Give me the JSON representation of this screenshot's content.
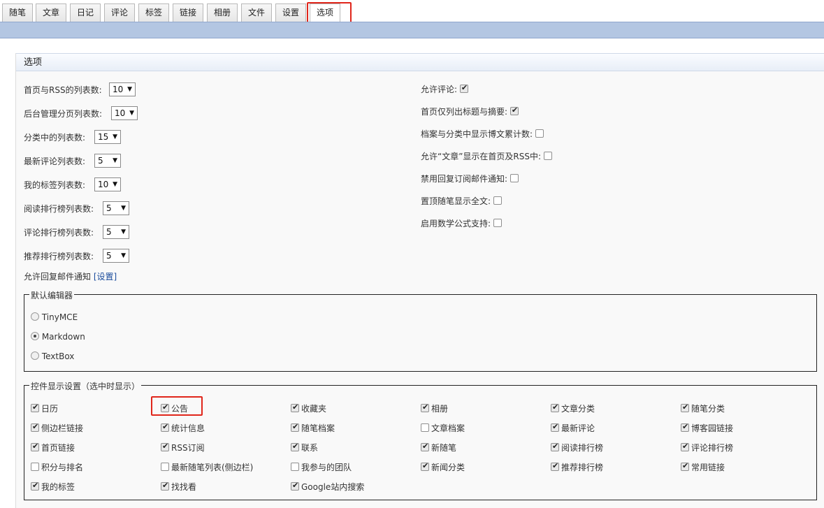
{
  "tabs": [
    "随笔",
    "文章",
    "日记",
    "评论",
    "标签",
    "链接",
    "相册",
    "文件",
    "设置",
    "选项"
  ],
  "active_tab": "选项",
  "section_title": "选项",
  "left_options": [
    {
      "label": "首页与RSS的列表数:",
      "value": "10"
    },
    {
      "label": "后台管理分页列表数:",
      "value": "10"
    },
    {
      "label": "分类中的列表数:",
      "value": "15"
    },
    {
      "label": "最新评论列表数:",
      "value": "5"
    },
    {
      "label": "我的标签列表数:",
      "value": "10"
    },
    {
      "label": "阅读排行榜列表数:",
      "value": "5"
    },
    {
      "label": "评论排行榜列表数:",
      "value": "5"
    },
    {
      "label": "推荐排行榜列表数:",
      "value": "5"
    }
  ],
  "mail_notify": {
    "label": "允许回复邮件通知",
    "link": "[设置]"
  },
  "right_options": [
    {
      "label": "允许评论:",
      "checked": true
    },
    {
      "label": "首页仅列出标题与摘要:",
      "checked": true
    },
    {
      "label": "档案与分类中显示博文累计数:",
      "checked": false
    },
    {
      "label": "允许“文章”显示在首页及RSS中:",
      "checked": false
    },
    {
      "label": "禁用回复订阅邮件通知:",
      "checked": false
    },
    {
      "label": "置顶随笔显示全文:",
      "checked": false
    },
    {
      "label": "启用数学公式支持:",
      "checked": false
    }
  ],
  "editor": {
    "legend": "默认编辑器",
    "options": [
      {
        "label": "TinyMCE",
        "selected": false
      },
      {
        "label": "Markdown",
        "selected": true
      },
      {
        "label": "TextBox",
        "selected": false
      }
    ]
  },
  "widgets": {
    "legend": "控件显示设置（选中时显示）",
    "rows": [
      [
        {
          "label": "日历",
          "checked": true
        },
        {
          "label": "公告",
          "checked": true
        },
        {
          "label": "收藏夹",
          "checked": true
        },
        {
          "label": "相册",
          "checked": true
        },
        {
          "label": "文章分类",
          "checked": true
        },
        {
          "label": "随笔分类",
          "checked": true
        }
      ],
      [
        {
          "label": "侧边栏链接",
          "checked": true
        },
        {
          "label": "统计信息",
          "checked": true
        },
        {
          "label": "随笔档案",
          "checked": true
        },
        {
          "label": "文章档案",
          "checked": false
        },
        {
          "label": "最新评论",
          "checked": true
        },
        {
          "label": "博客园链接",
          "checked": true
        }
      ],
      [
        {
          "label": "首页链接",
          "checked": true
        },
        {
          "label": "RSS订阅",
          "checked": true
        },
        {
          "label": "联系",
          "checked": true
        },
        {
          "label": "新随笔",
          "checked": true
        },
        {
          "label": "阅读排行榜",
          "checked": true
        },
        {
          "label": "评论排行榜",
          "checked": true
        }
      ],
      [
        {
          "label": "积分与排名",
          "checked": false
        },
        {
          "label": "最新随笔列表(侧边栏)",
          "checked": false
        },
        {
          "label": "我参与的团队",
          "checked": false
        },
        {
          "label": "新闻分类",
          "checked": true
        },
        {
          "label": "推荐排行榜",
          "checked": true
        },
        {
          "label": "常用链接",
          "checked": true
        }
      ],
      [
        {
          "label": "我的标签",
          "checked": true
        },
        {
          "label": "找找看",
          "checked": true
        },
        {
          "label": "Google站内搜索",
          "checked": true
        }
      ]
    ]
  },
  "colors": {
    "highlight": "#e0261b",
    "header_bar": "#b3c6e2",
    "link": "#1a4c9c"
  }
}
